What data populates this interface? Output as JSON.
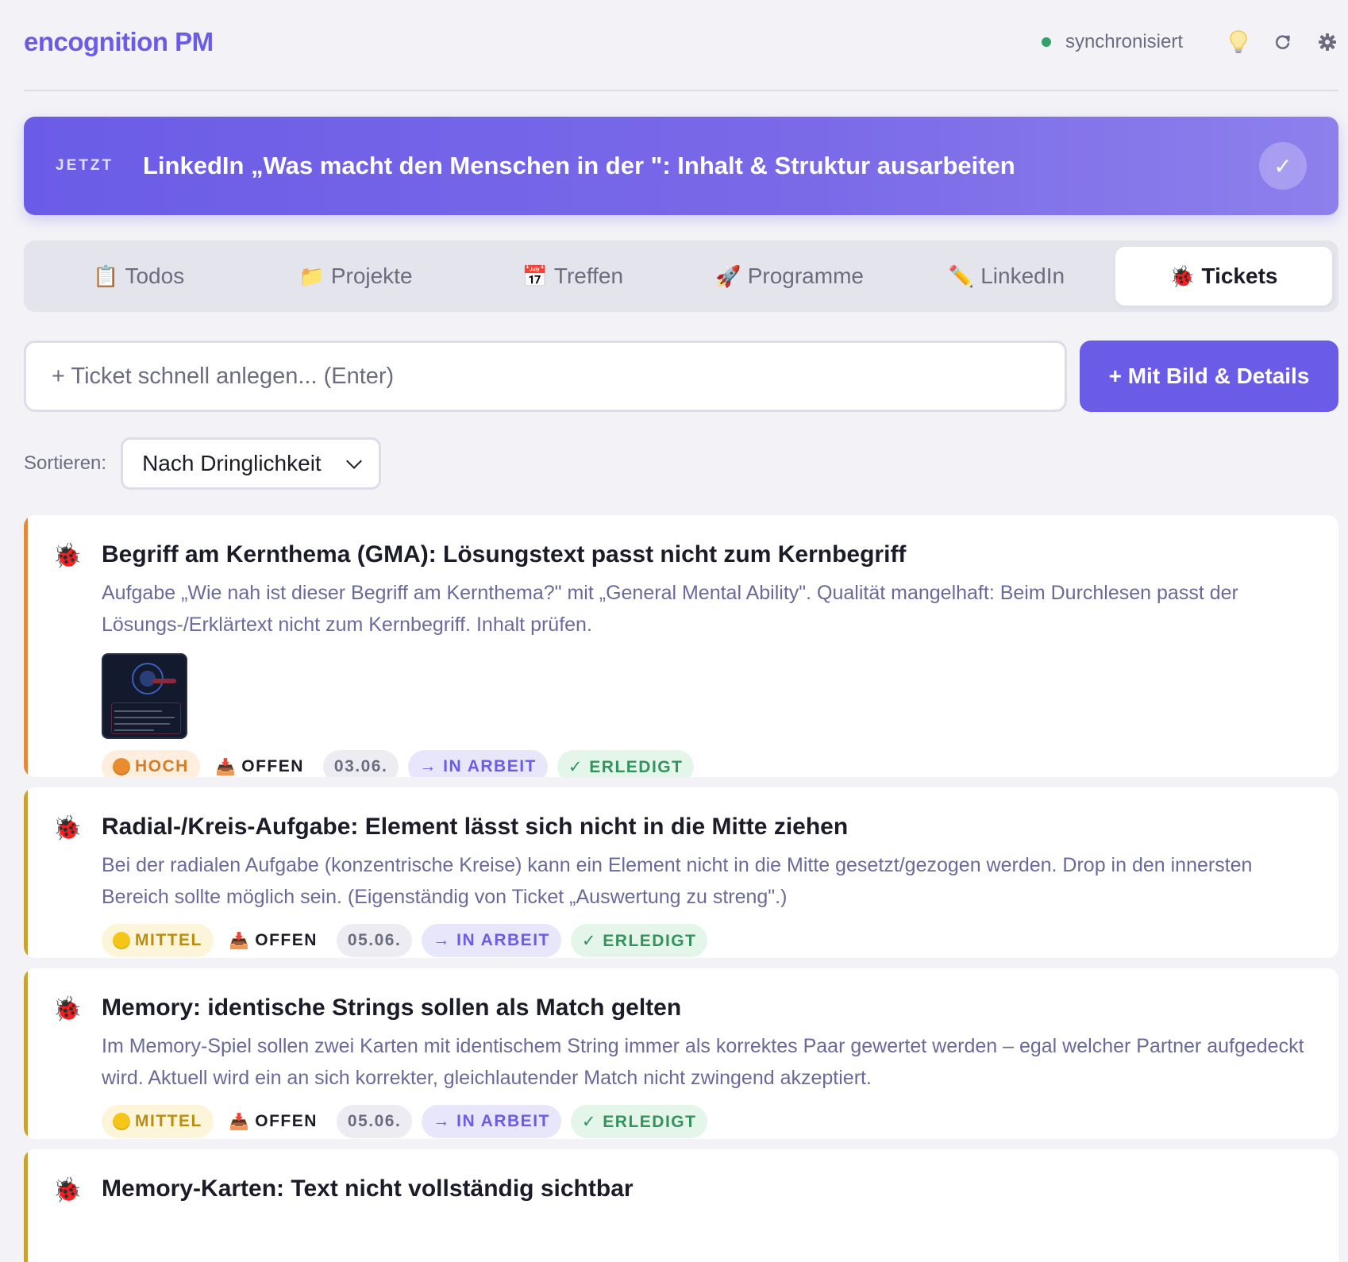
{
  "header": {
    "brand": "encognition PM",
    "sync_status": "synchronisiert",
    "icons": [
      "lightbulb-icon",
      "refresh-icon",
      "gear-icon"
    ]
  },
  "now": {
    "label": "JETZT",
    "title": "LinkedIn „Was macht den Menschen in der \": Inhalt & Struktur ausarbeiten",
    "check": "✓"
  },
  "tabs": [
    {
      "icon": "📋",
      "label": "Todos"
    },
    {
      "icon": "📁",
      "label": "Projekte"
    },
    {
      "icon": "📅",
      "label": "Treffen"
    },
    {
      "icon": "🚀",
      "label": "Programme"
    },
    {
      "icon": "✏️",
      "label": "LinkedIn"
    },
    {
      "icon": "🐞",
      "label": "Tickets",
      "active": true
    }
  ],
  "quick_add": {
    "placeholder": "+ Ticket schnell anlegen... (Enter)",
    "button_label": "+ Mit Bild & Details"
  },
  "sort": {
    "label": "Sortieren:",
    "selected": "Nach Dringlichkeit"
  },
  "tickets": [
    {
      "priority": "HOCH",
      "title": "Begriff am Kernthema (GMA): Lösungstext passt nicht zum Kernbegriff",
      "description": "Aufgabe „Wie nah ist dieser Begriff am Kernthema?\" mit „General Mental Ability\". Qualität mangelhaft: Beim Durchlesen passt der Lösungs-/Erklärtext nicht zum Kernbegriff. Inhalt prüfen.",
      "status": "OFFEN",
      "date": "03.06.",
      "action_progress": "→ IN ARBEIT",
      "action_done": "✓ ERLEDIGT"
    },
    {
      "priority": "MITTEL",
      "title": "Radial-/Kreis-Aufgabe: Element lässt sich nicht in die Mitte ziehen",
      "description": "Bei der radialen Aufgabe (konzentrische Kreise) kann ein Element nicht in die Mitte gesetzt/gezogen werden. Drop in den innersten Bereich sollte möglich sein. (Eigenständig von Ticket „Auswertung zu streng\".)",
      "status": "OFFEN",
      "date": "05.06.",
      "action_progress": "→ IN ARBEIT",
      "action_done": "✓ ERLEDIGT"
    },
    {
      "priority": "MITTEL",
      "title": "Memory: identische Strings sollen als Match gelten",
      "description": "Im Memory-Spiel sollen zwei Karten mit identischem String immer als korrektes Paar gewertet werden – egal welcher Partner aufgedeckt wird. Aktuell wird ein an sich korrekter, gleichlautender Match nicht zwingend akzeptiert.",
      "status": "OFFEN",
      "date": "05.06.",
      "action_progress": "→ IN ARBEIT",
      "action_done": "✓ ERLEDIGT"
    },
    {
      "title": "Memory-Karten: Text nicht vollständig sichtbar"
    }
  ],
  "colors": {
    "accent": "#6b5ce7",
    "high": "#e08a3c",
    "medium": "#c9a332",
    "done": "#34925e"
  }
}
